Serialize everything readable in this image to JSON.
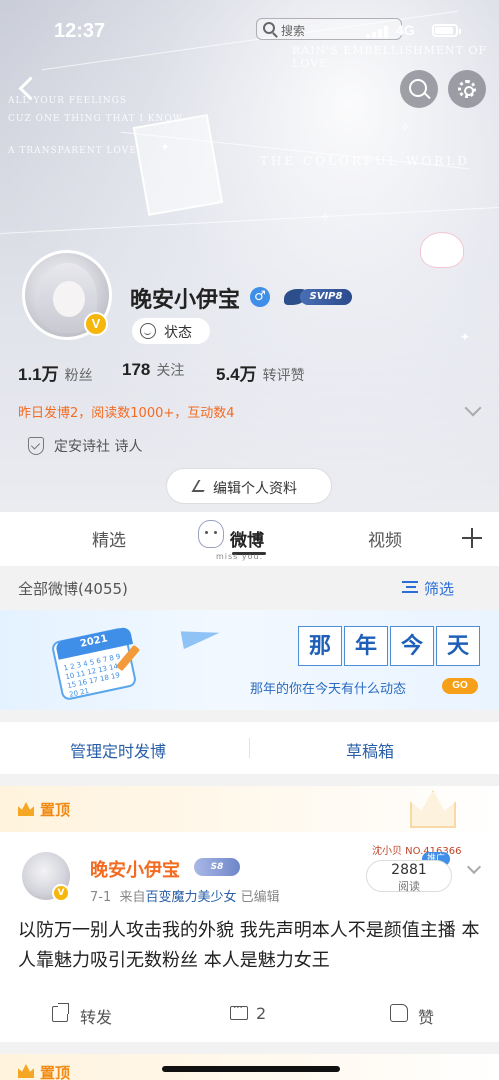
{
  "status_bar": {
    "time": "12:37",
    "search_placeholder": "搜索",
    "network": "4G"
  },
  "cover": {
    "text_line1": "RAIN'S EMBELLISHMENT OF LOVE.",
    "text_line2": "THE COLORFUL WORLD",
    "text_left1": "ALL YOUR FEELINGS",
    "text_left2": "CUZ ONE THING THAT I KNOW",
    "text_left3": "A TRANSPARENT LOVE"
  },
  "profile": {
    "username": "晚安小伊宝",
    "gender_symbol": "♂",
    "vip_label": "SVIP8",
    "verified_badge": "V",
    "status_label": "状态",
    "stats": [
      {
        "value": "1.1万",
        "label": "粉丝"
      },
      {
        "value": "178",
        "label": "关注"
      },
      {
        "value": "5.4万",
        "label": "转评赞"
      }
    ],
    "activity_text": "昨日发博2，阅读数1000+，互动数4",
    "tag_text": "定安诗社 诗人",
    "edit_button": "编辑个人资料"
  },
  "tabs": {
    "items": [
      "精选",
      "微博",
      "视频"
    ],
    "active": "微博",
    "mascot_caption": "miss you."
  },
  "filter_bar": {
    "all_posts": "全部微博(4055)",
    "filter_label": "筛选"
  },
  "banner": {
    "calendar_year": "2021",
    "calendar_days": "1 2 3 4 5 6 7 8 9 10 11 12 13 14 15 16 17 18 19 20 21",
    "chars": [
      "那",
      "年",
      "今",
      "天"
    ],
    "subtitle": "那年的你在今天有什么动态",
    "go_label": "GO"
  },
  "actions_row": {
    "scheduled_post": "管理定时发博",
    "drafts": "草稿箱"
  },
  "post": {
    "pin_label": "置顶",
    "author": "晚安小伊宝",
    "author_vip": "S8",
    "verified_badge": "V",
    "date": "7-1",
    "source_prefix": "来自",
    "source": "百变魔力美少女",
    "edited": "已编辑",
    "read_tag": "沈小贝 NO.416366",
    "promo_tag": "推广",
    "read_count": "2881",
    "read_label": "阅读",
    "text": "以防万一别人攻击我的外貌 我先声明本人不是颜值主播 本人靠魅力吸引无数粉丝 本人是魅力女王",
    "actions": {
      "repost": "转发",
      "comment_count": "2",
      "like": "赞"
    }
  },
  "next_post": {
    "pin_label": "置顶"
  }
}
